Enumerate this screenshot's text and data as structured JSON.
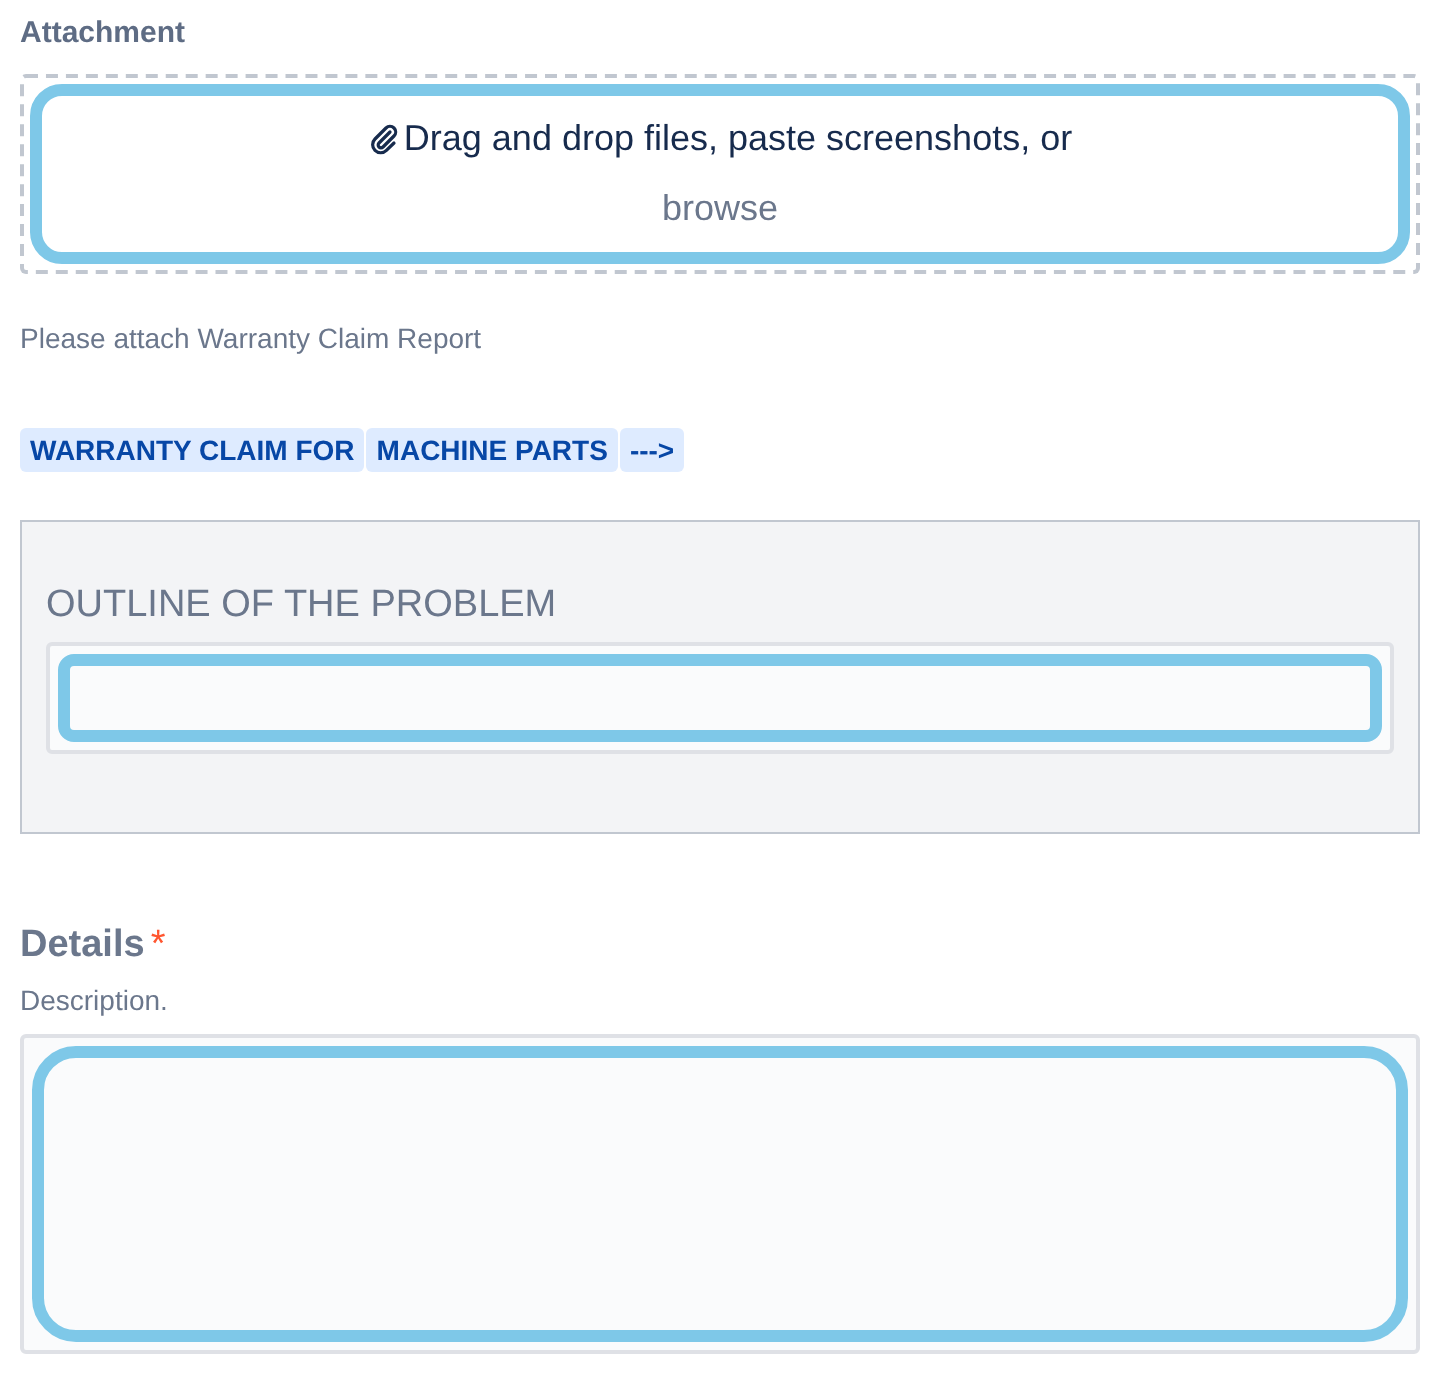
{
  "attachment": {
    "label": "Attachment",
    "prompt": "Drag and drop files, paste screenshots, or",
    "browse_link": "browse",
    "highlighted": true,
    "help": "Please attach Warranty Claim Report"
  },
  "tags": [
    "WARRANTY CLAIM FOR",
    "MACHINE PARTS",
    "--->"
  ],
  "outline_panel": {
    "heading": "OUTLINE OF THE PROBLEM",
    "field": {
      "highlighted": true
    }
  },
  "details": {
    "label": "Details",
    "required_mark": "*",
    "description": "Description.",
    "field": {
      "highlighted": true
    }
  }
}
